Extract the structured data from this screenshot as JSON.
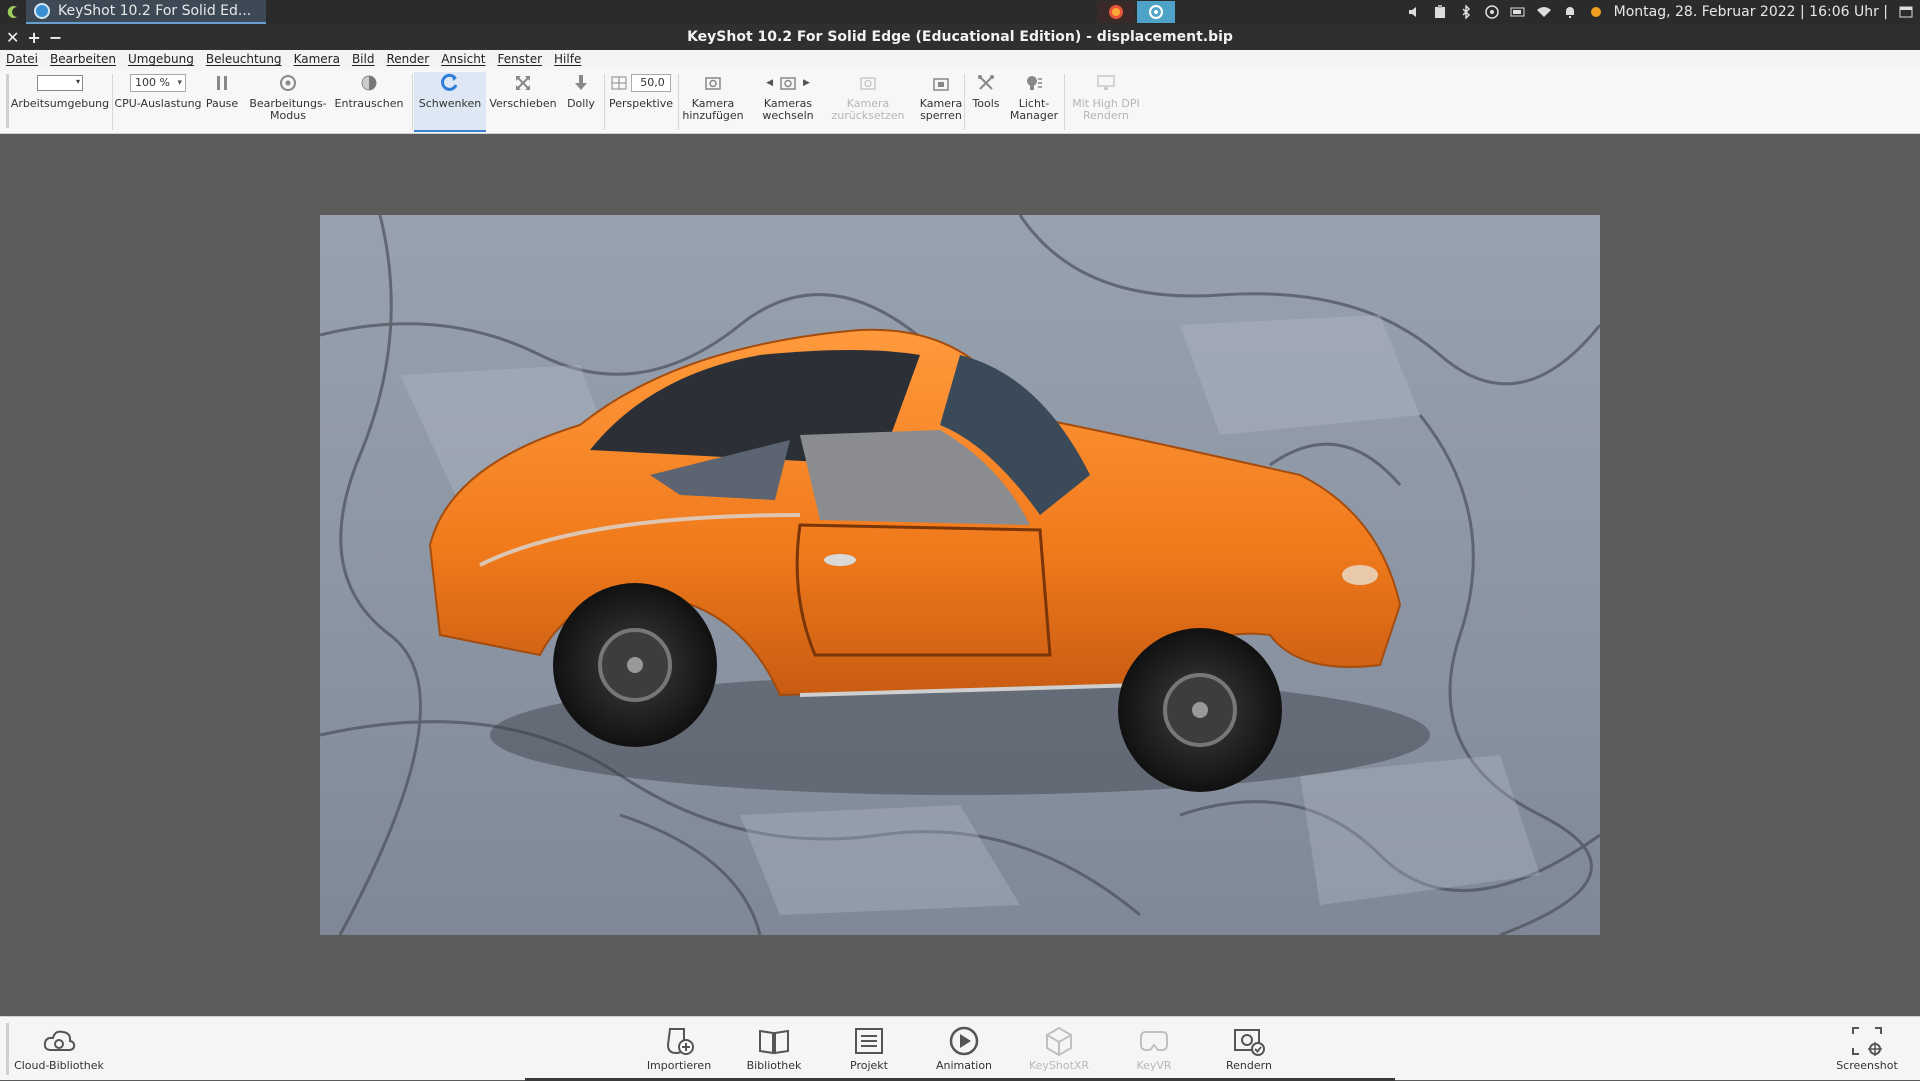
{
  "system_panel": {
    "task_title": "KeyShot 10.2 For Solid Ed...",
    "clock": "Montag, 28. Februar 2022 | 16:06 Uhr |",
    "tray_icons": [
      "volume-icon",
      "clipboard-icon",
      "bluetooth-icon",
      "network-icon",
      "battery-icon",
      "wifi-icon",
      "bell-icon",
      "status-dot-icon",
      "window-icon"
    ]
  },
  "window": {
    "title": "KeyShot 10.2 For Solid Edge (Educational Edition) - displacement.bip",
    "controls": [
      "✕",
      "+",
      "−"
    ]
  },
  "menu": [
    "Datei",
    "Bearbeiten",
    "Umgebung",
    "Beleuchtung",
    "Kamera",
    "Bild",
    "Render",
    "Ansicht",
    "Fenster",
    "Hilfe"
  ],
  "toolbar": {
    "workspace_label": "Arbeitsumgebung",
    "cpu_value": "100 %",
    "cpu_label": "CPU-Auslastung",
    "pause_label": "Pause",
    "edit_mode_label_1": "Bearbeitungs-",
    "edit_mode_label_2": "Modus",
    "denoise_label": "Entrauschen",
    "tumble_label": "Schwenken",
    "pan_label": "Verschieben",
    "dolly_label": "Dolly",
    "perspective_value": "50,0",
    "perspective_label": "Perspektive",
    "add_camera_label_1": "Kamera",
    "add_camera_label_2": "hinzufügen",
    "switch_camera_label_1": "Kameras",
    "switch_camera_label_2": "wechseln",
    "reset_camera_label_1": "Kamera",
    "reset_camera_label_2": "zurücksetzen",
    "lock_camera_label_1": "Kamera",
    "lock_camera_label_2": "sperren",
    "tools_label": "Tools",
    "light_manager_label_1": "Licht-",
    "light_manager_label_2": "Manager",
    "hidpi_label_1": "Mit High DPI",
    "hidpi_label_2": "Rendern"
  },
  "bottombar": {
    "cloud_library": "Cloud-Bibliothek",
    "import": "Importieren",
    "library": "Bibliothek",
    "project": "Projekt",
    "animation": "Animation",
    "keyshotxr": "KeyShotXR",
    "keyvr": "KeyVR",
    "render": "Rendern",
    "screenshot": "Screenshot"
  },
  "colors": {
    "accent": "#3b7fd0",
    "car_orange": "#f07a1c",
    "stone_grey": "#8c96a6"
  }
}
